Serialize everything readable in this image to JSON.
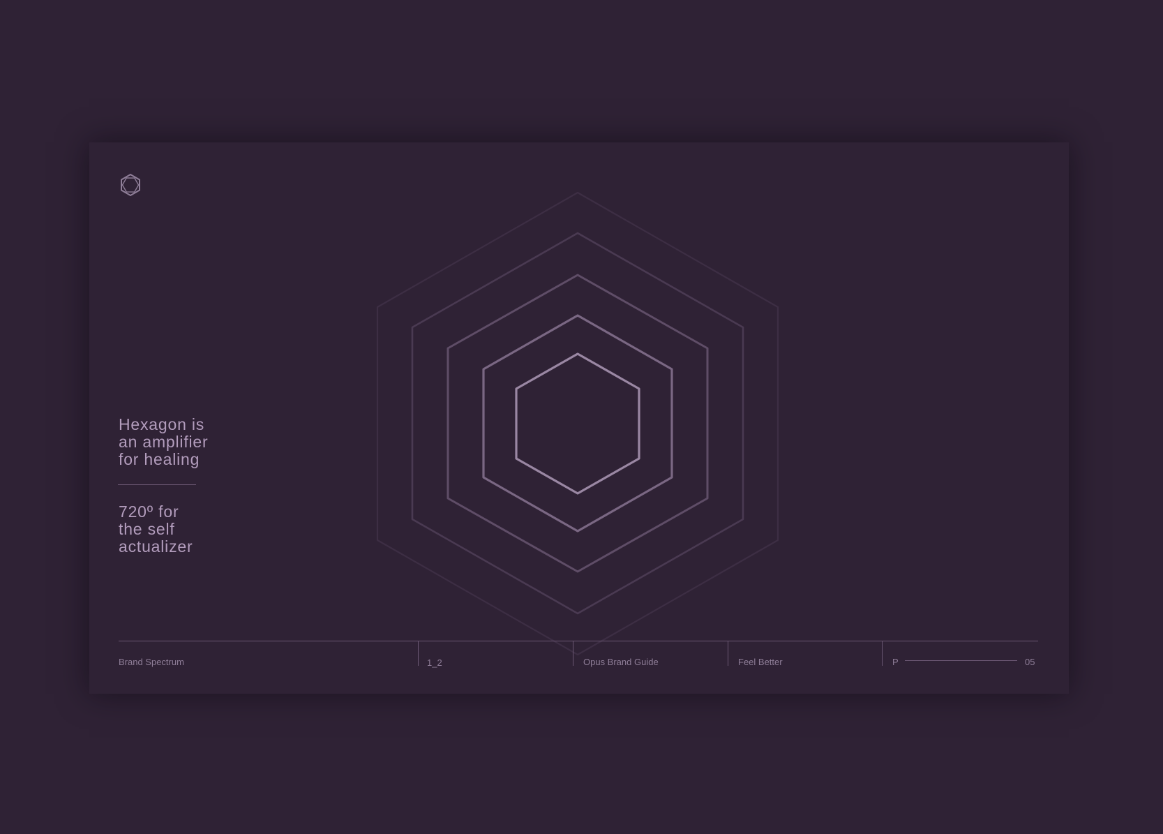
{
  "statements": {
    "first": [
      "Hexagon is",
      "an amplifier",
      "for healing"
    ],
    "second": [
      "720º for",
      "the self",
      "actualizer"
    ]
  },
  "footer": {
    "section": "Brand Spectrum",
    "chapter": "1_2",
    "guide": "Opus Brand Guide",
    "tagline": "Feel Better",
    "page_prefix": "P",
    "page_number": "05"
  },
  "icons": {
    "logo": "hexagon-logo-icon"
  },
  "colors": {
    "background": "#2f2235",
    "text": "#b39dbd",
    "muted_text": "#8f7e98",
    "rule": "#6b5773"
  }
}
